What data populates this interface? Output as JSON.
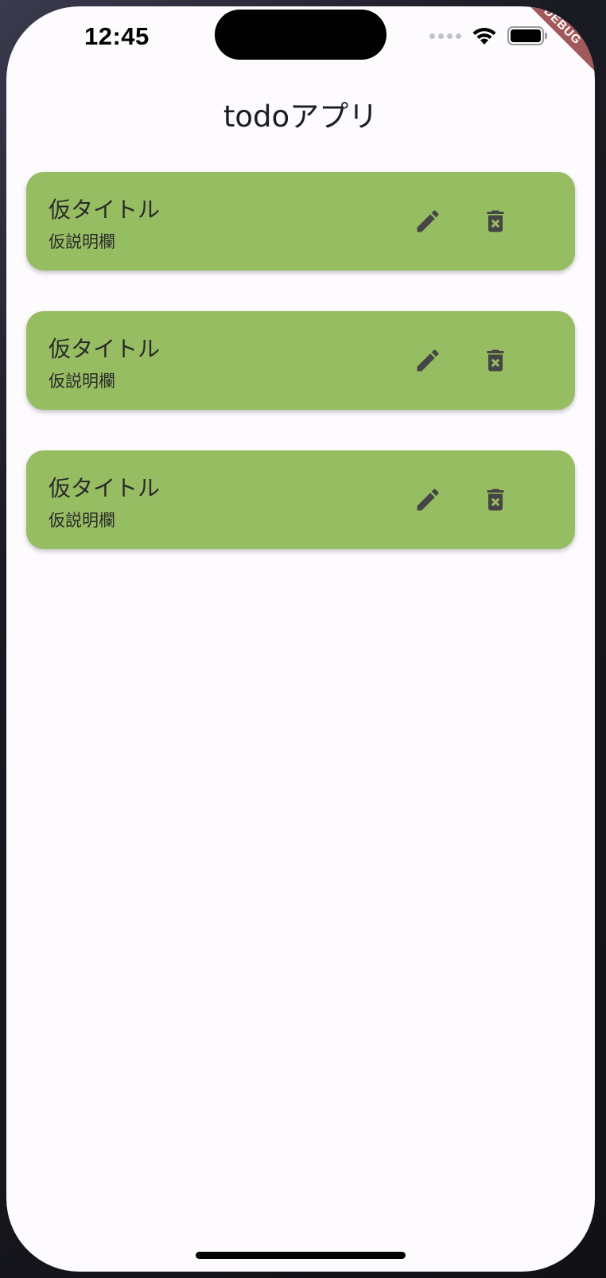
{
  "status_bar": {
    "time": "12:45",
    "debug_label": "DEBUG"
  },
  "app_bar": {
    "title": "todoアプリ"
  },
  "todos": [
    {
      "title": "仮タイトル",
      "description": "仮説明欄"
    },
    {
      "title": "仮タイトル",
      "description": "仮説明欄"
    },
    {
      "title": "仮タイトル",
      "description": "仮説明欄"
    }
  ],
  "icons": {
    "edit": "pencil-icon",
    "delete": "trash-icon"
  },
  "colors": {
    "card": "#97bd62",
    "background": "#fdfbfe",
    "icon": "#454545",
    "debug_banner": "#a3595c"
  }
}
